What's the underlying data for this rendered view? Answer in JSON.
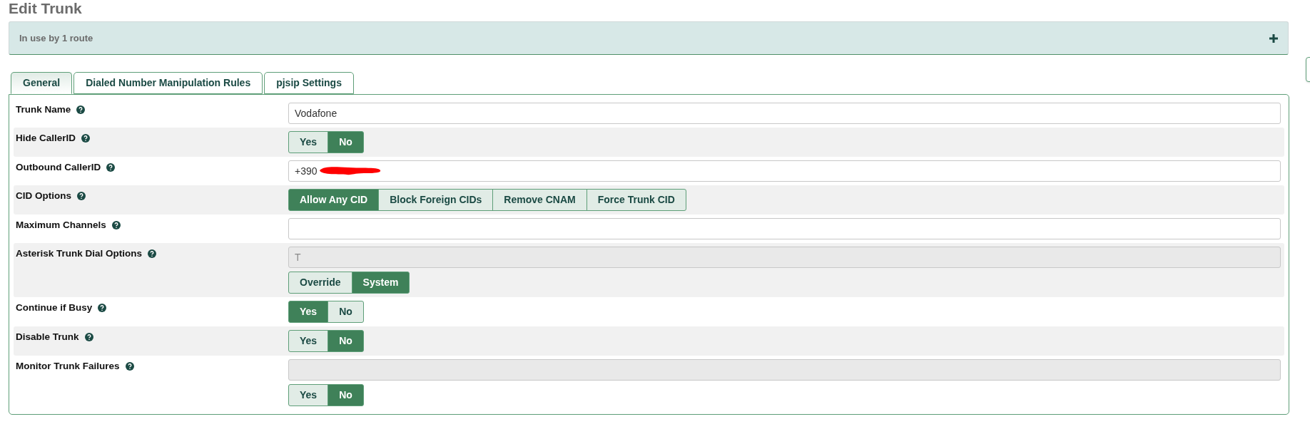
{
  "page_title": "Edit Trunk",
  "usage_panel": {
    "text": "In use by 1 route",
    "expanded": false
  },
  "tabs": [
    {
      "label": "General",
      "selected": true
    },
    {
      "label": "Dialed Number Manipulation Rules",
      "selected": false
    },
    {
      "label": "pjsip Settings",
      "selected": false
    }
  ],
  "fields": [
    {
      "label": "Trunk Name",
      "kind": "text",
      "value": "Vodafone"
    },
    {
      "label": "Hide CallerID",
      "kind": "toggle",
      "options": [
        {
          "label": "Yes",
          "selected": false
        },
        {
          "label": "No",
          "selected": true
        }
      ]
    },
    {
      "label": "Outbound CallerID",
      "kind": "text",
      "value": "+390",
      "redacted": true
    },
    {
      "label": "CID Options",
      "kind": "toggle",
      "options": [
        {
          "label": "Allow Any CID",
          "selected": true
        },
        {
          "label": "Block Foreign CIDs",
          "selected": false
        },
        {
          "label": "Remove CNAM",
          "selected": false
        },
        {
          "label": "Force Trunk CID",
          "selected": false
        }
      ]
    },
    {
      "label": "Maximum Channels",
      "kind": "text"
    },
    {
      "label": "Asterisk Trunk Dial Options",
      "kind": "text_toggle",
      "value": "T",
      "disabled": true,
      "options": [
        {
          "label": "Override",
          "selected": false
        },
        {
          "label": "System",
          "selected": true
        }
      ]
    },
    {
      "label": "Continue if Busy",
      "kind": "toggle",
      "options": [
        {
          "label": "Yes",
          "selected": true
        },
        {
          "label": "No",
          "selected": false
        }
      ]
    },
    {
      "label": "Disable Trunk",
      "kind": "toggle",
      "options": [
        {
          "label": "Yes",
          "selected": false
        },
        {
          "label": "No",
          "selected": true
        }
      ]
    },
    {
      "label": "Monitor Trunk Failures",
      "kind": "text_toggle",
      "disabled": true,
      "options": [
        {
          "label": "Yes",
          "selected": false
        },
        {
          "label": "No",
          "selected": true
        }
      ]
    }
  ]
}
